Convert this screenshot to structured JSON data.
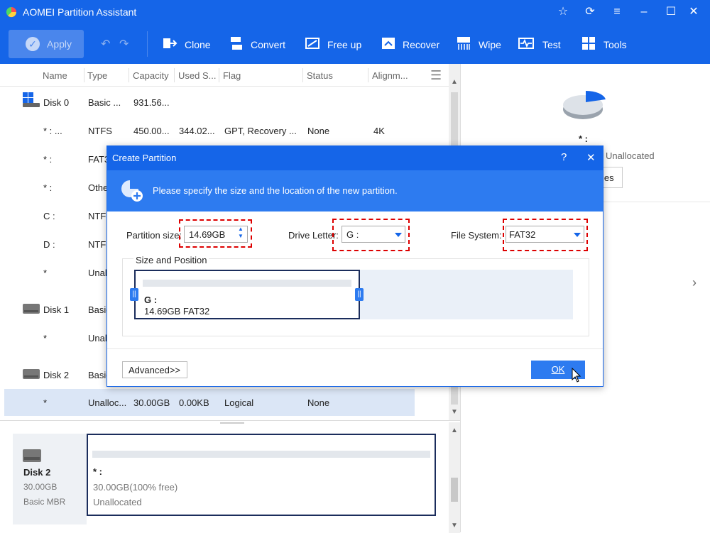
{
  "window": {
    "title": "AOMEI Partition Assistant"
  },
  "toolbar": {
    "apply": "Apply",
    "tools": [
      {
        "label": "Clone",
        "icon": "clone-icon"
      },
      {
        "label": "Convert",
        "icon": "convert-icon"
      },
      {
        "label": "Free up",
        "icon": "free-up-icon"
      },
      {
        "label": "Recover",
        "icon": "recover-icon"
      },
      {
        "label": "Wipe",
        "icon": "wipe-icon"
      },
      {
        "label": "Test",
        "icon": "test-icon"
      },
      {
        "label": "Tools",
        "icon": "tools-icon"
      }
    ]
  },
  "table": {
    "headers": [
      "Name",
      "Type",
      "Capacity",
      "Used S...",
      "Flag",
      "Status",
      "Alignm..."
    ],
    "rows": [
      {
        "name": "Disk 0",
        "type": "Basic ...",
        "capacity": "931.56...",
        "used": "",
        "flag": "",
        "status": "",
        "align": ""
      },
      {
        "name": "* : ...",
        "type": "NTFS",
        "capacity": "450.00...",
        "used": "344.02...",
        "flag": "GPT, Recovery ...",
        "status": "None",
        "align": "4K"
      },
      {
        "name": "* :",
        "type": "FAT3",
        "capacity": "",
        "used": "",
        "flag": "",
        "status": "",
        "align": ""
      },
      {
        "name": "* :",
        "type": "Othe",
        "capacity": "",
        "used": "",
        "flag": "",
        "status": "",
        "align": ""
      },
      {
        "name": "C :",
        "type": "NTFS",
        "capacity": "",
        "used": "",
        "flag": "",
        "status": "",
        "align": ""
      },
      {
        "name": "D :",
        "type": "NTFS",
        "capacity": "",
        "used": "",
        "flag": "",
        "status": "",
        "align": ""
      },
      {
        "name": "*",
        "type": "Unall",
        "capacity": "",
        "used": "",
        "flag": "",
        "status": "",
        "align": ""
      },
      {
        "name": "Disk 1",
        "type": "Basic",
        "capacity": "",
        "used": "",
        "flag": "",
        "status": "",
        "align": ""
      },
      {
        "name": "*",
        "type": "Unall",
        "capacity": "",
        "used": "",
        "flag": "",
        "status": "",
        "align": ""
      },
      {
        "name": "Disk 2",
        "type": "Basic",
        "capacity": "",
        "used": "",
        "flag": "",
        "status": "",
        "align": ""
      },
      {
        "name": "*",
        "type": "Unalloc...",
        "capacity": "30.00GB",
        "used": "0.00KB",
        "flag": "Logical",
        "status": "None",
        "align": ""
      }
    ]
  },
  "right_panel": {
    "part_label": "* :",
    "part_type": "Unallocated",
    "properties_btn": "ies"
  },
  "diskmap": {
    "disk_name": "Disk 2",
    "disk_size": "30.00GB",
    "disk_type": "Basic MBR",
    "part_label": "* :",
    "part_size": "30.00GB(100% free)",
    "part_type": "Unallocated"
  },
  "dialog": {
    "title": "Create Partition",
    "help": "?",
    "banner": "Please specify the size and the location of the new partition.",
    "size_label": "Partition size:",
    "size_value": "14.69GB",
    "letter_label": "Drive Letter:",
    "letter_value": "G :",
    "fs_label": "File System:",
    "fs_value": "FAT32",
    "group_label": "Size and Position",
    "part_label": "G :",
    "part_info": "14.69GB FAT32",
    "advanced": "Advanced>>",
    "ok": "OK"
  }
}
